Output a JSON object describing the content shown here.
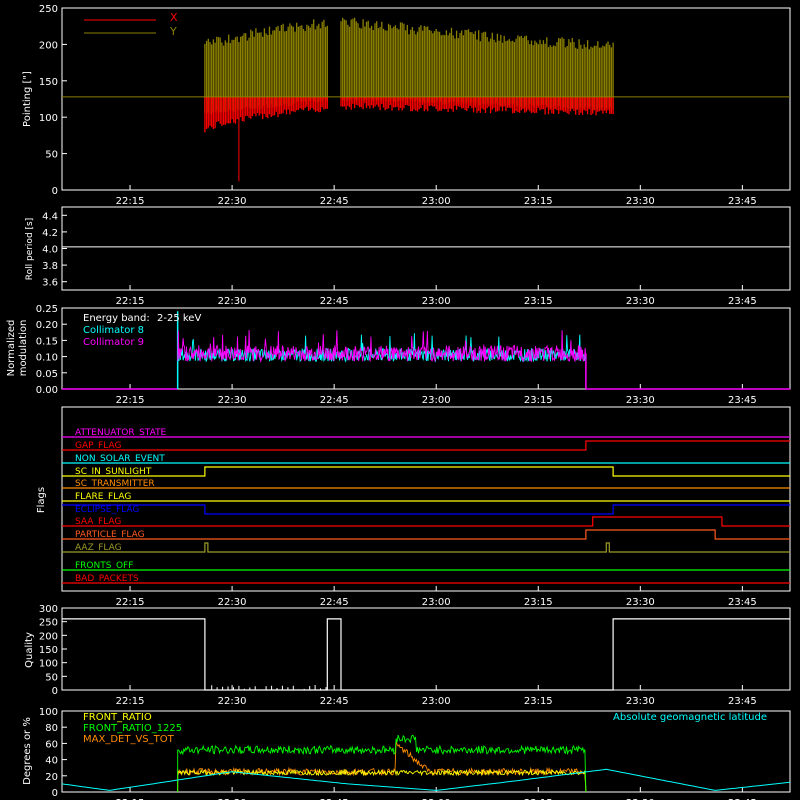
{
  "colors": {
    "background": "#000000",
    "axes": "#ffffff",
    "x_red": "#ff0000",
    "y_olive": "#8b8000",
    "cyan": "#00ffff",
    "magenta": "#ff00ff",
    "green": "#00ff00",
    "orange": "#ff8c00",
    "yellow": "#ffff00",
    "blue": "#0000ff",
    "sienna": "#ff5a1e",
    "olive_flag": "#9b9b2a"
  },
  "time_ticks": [
    "22:15",
    "22:30",
    "22:45",
    "23:00",
    "23:15",
    "23:30",
    "23:45"
  ],
  "chart_data": [
    {
      "type": "line",
      "ylabel": "Pointing [\"]",
      "ylim": [
        0,
        250
      ],
      "yticks": [
        "0",
        "50",
        "100",
        "150",
        "200",
        "250"
      ],
      "reference_line": 128,
      "x_range": [
        "22:05",
        "23:52"
      ],
      "gaps": [
        [
          "22:44",
          "22:46"
        ]
      ],
      "series": [
        {
          "name": "X",
          "lower_envelope": [
            [
              "22:26",
              78
            ],
            [
              "22:29",
              88
            ],
            [
              "22:35",
              98
            ],
            [
              "22:44",
              108
            ],
            [
              "22:47",
              110
            ],
            [
              "23:00",
              107
            ],
            [
              "23:15",
              104
            ],
            [
              "23:26",
              100
            ]
          ],
          "upper_envelope": [
            [
              "22:26",
              128
            ],
            [
              "23:26",
              128
            ]
          ],
          "spike_min": [
            "22:31",
            12
          ]
        },
        {
          "name": "Y",
          "lower_envelope": [
            [
              "22:26",
              102
            ],
            [
              "22:35",
              112
            ],
            [
              "22:44",
              120
            ],
            [
              "22:47",
              122
            ],
            [
              "23:00",
              118
            ],
            [
              "23:15",
              112
            ],
            [
              "23:26",
              108
            ]
          ],
          "upper_envelope": [
            [
              "22:26",
              208
            ],
            [
              "22:35",
              225
            ],
            [
              "22:44",
              238
            ],
            [
              "22:47",
              238
            ],
            [
              "23:00",
              225
            ],
            [
              "23:15",
              212
            ],
            [
              "23:26",
              205
            ]
          ]
        }
      ]
    },
    {
      "type": "line",
      "ylabel": "Roll period [s]",
      "ylim": [
        3.5,
        4.5
      ],
      "yticks": [
        "3.6",
        "3.8",
        "4.0",
        "4.2",
        "4.4"
      ],
      "series": [
        {
          "name": "",
          "x": [
            "22:05",
            "23:52"
          ],
          "y": [
            4.02,
            4.02
          ]
        }
      ]
    },
    {
      "type": "line",
      "ylabel": "Normalized modulation",
      "ylim": [
        0,
        0.25
      ],
      "yticks": [
        "0.00",
        "0.05",
        "0.10",
        "0.15",
        "0.20",
        "0.25"
      ],
      "annotation": {
        "label": "Energy band:",
        "value": "2-25 keV"
      },
      "series": [
        {
          "name": "Collimator 8",
          "x_range": [
            "22:22",
            "23:22"
          ],
          "mean": 0.105,
          "spread": 0.02
        },
        {
          "name": "Collimator 9",
          "x_range": [
            "22:22",
            "23:22"
          ],
          "mean": 0.11,
          "spread": 0.025
        }
      ]
    },
    {
      "type": "line",
      "ylabel": "Flags",
      "flags": [
        {
          "name": "ATTENUATOR_STATE",
          "color": "#ff00ff",
          "segments": []
        },
        {
          "name": "GAP_FLAG",
          "color": "#ff0000",
          "segments": [
            [
              "23:22",
              "23:52"
            ]
          ]
        },
        {
          "name": "NON_SOLAR_EVENT",
          "color": "#00ffff",
          "segments": []
        },
        {
          "name": "SC_IN_SUNLIGHT",
          "color": "#ffff00",
          "segments": [
            [
              "22:26",
              "23:26"
            ]
          ]
        },
        {
          "name": "SC_TRANSMITTER",
          "color": "#ff8c00",
          "segments": []
        },
        {
          "name": "FLARE_FLAG",
          "color": "#ffff00",
          "segments": []
        },
        {
          "name": "ECLIPSE_FLAG",
          "color": "#0000ff",
          "segments": [
            [
              "22:05",
              "22:26"
            ],
            [
              "23:26",
              "23:52"
            ]
          ]
        },
        {
          "name": "SAA_FLAG",
          "color": "#ff0000",
          "segments": [
            [
              "23:23",
              "23:42"
            ]
          ]
        },
        {
          "name": "PARTICLE_FLAG",
          "color": "#ff5a1e",
          "segments": [
            [
              "23:22",
              "23:41"
            ]
          ]
        },
        {
          "name": "AAZ_FLAG",
          "color": "#9b9b2a",
          "segments": [
            [
              "22:26",
              "22:26"
            ],
            [
              "23:25",
              "23:25"
            ]
          ]
        },
        {
          "name": "FRONTS_OFF",
          "color": "#00ff00",
          "segments": []
        },
        {
          "name": "BAD_PACKETS",
          "color": "#ff0000",
          "segments": []
        }
      ]
    },
    {
      "type": "line",
      "ylabel": "Quality",
      "ylim": [
        0,
        300
      ],
      "yticks": [
        "0",
        "50",
        "100",
        "150",
        "200",
        "250",
        "300"
      ],
      "series": [
        {
          "name": "",
          "x": [
            "22:05",
            "22:26",
            "22:26",
            "22:44",
            "22:44",
            "22:46",
            "22:46",
            "23:26",
            "23:26",
            "23:52"
          ],
          "y": [
            260,
            260,
            0,
            0,
            260,
            260,
            0,
            0,
            260,
            260
          ]
        }
      ]
    },
    {
      "type": "line",
      "ylabel": "Degrees or %",
      "ylim": [
        0,
        100
      ],
      "yticks": [
        "0",
        "20",
        "40",
        "60",
        "80",
        "100"
      ],
      "legend_right": "Absolute geomagnetic latitude",
      "series": [
        {
          "name": "FRONT_RATIO",
          "color": "#ffff00",
          "x_range": [
            "22:22",
            "23:22"
          ],
          "mean": 24
        },
        {
          "name": "FRONT_RATIO_1225",
          "color": "#00ff00",
          "x_range": [
            "22:22",
            "23:22"
          ],
          "mean": 52
        },
        {
          "name": "MAX_DET_VS_TOT",
          "color": "#ff8c00",
          "x_range": [
            "22:22",
            "23:22"
          ],
          "mean": 25
        },
        {
          "name": "Absolute geomagnetic latitude",
          "color": "#00ffff",
          "x": [
            "22:05",
            "22:12",
            "22:30",
            "22:47",
            "23:00",
            "23:10",
            "23:25",
            "23:41",
            "23:52"
          ],
          "y": [
            10,
            2,
            25,
            10,
            2,
            12,
            28,
            2,
            12
          ]
        }
      ]
    }
  ]
}
